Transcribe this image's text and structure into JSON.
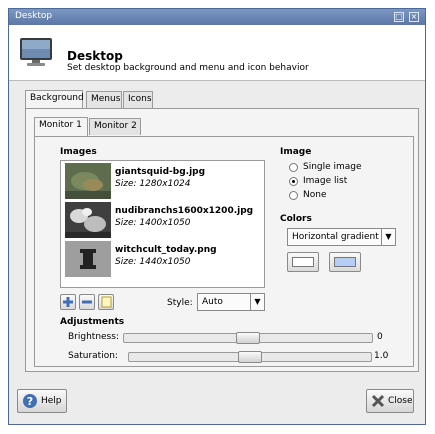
{
  "window": {
    "title": "Desktop",
    "titlebar_buttons": [
      "restore-icon",
      "close-icon"
    ]
  },
  "header": {
    "title": "Desktop",
    "subtitle": "Set desktop background and menu and icon behavior",
    "icon": "desktop-monitor-icon"
  },
  "tabs": [
    {
      "label": "Background",
      "active": true
    },
    {
      "label": "Menus",
      "active": false
    },
    {
      "label": "Icons",
      "active": false
    }
  ],
  "monitor_tabs": [
    {
      "label": "Monitor 1",
      "active": true
    },
    {
      "label": "Monitor 2",
      "active": false
    }
  ],
  "images": {
    "label": "Images",
    "items": [
      {
        "name": "giantsquid-bg.jpg",
        "size": "Size: 1280x1024"
      },
      {
        "name": "nudibranchs1600x1200.jpg",
        "size": "Size: 1400x1050"
      },
      {
        "name": "witchcult_today.png",
        "size": "Size: 1440x1050"
      }
    ],
    "buttons": [
      "add-icon",
      "remove-icon",
      "clear-list-icon"
    ]
  },
  "style": {
    "label": "Style:",
    "value": "Auto"
  },
  "image_options": {
    "label": "Image",
    "options": [
      "Single image",
      "Image list",
      "None"
    ],
    "selected": "Image list"
  },
  "colors": {
    "label": "Colors",
    "mode": "Horizontal gradient",
    "color1": "#ffffff",
    "color2": "#b6cdf3"
  },
  "adjustments": {
    "label": "Adjustments",
    "brightness": {
      "label": "Brightness:",
      "value": "0",
      "position": 0.5
    },
    "saturation": {
      "label": "Saturation:",
      "value": "1.0",
      "position": 0.5
    }
  },
  "footer": {
    "help": "Help",
    "close": "Close"
  }
}
